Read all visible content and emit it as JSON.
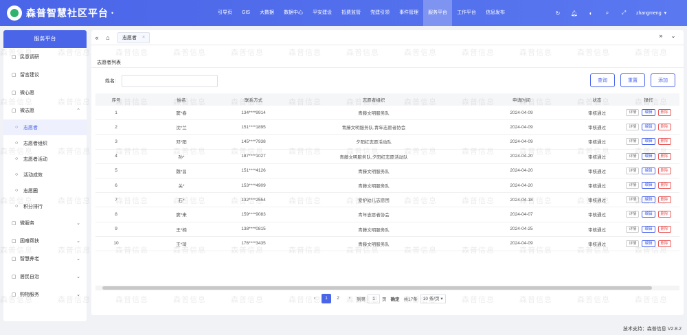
{
  "app": {
    "title": "森普智慧社区平台"
  },
  "topnav": [
    "引导页",
    "GIS",
    "大数据",
    "数据中心",
    "平安建设",
    "抵费监管",
    "党建引领",
    "事件管理",
    "服务平台",
    "工作平台",
    "信息发布"
  ],
  "topnav_active": "服务平台",
  "user": {
    "name": "zhangmeng"
  },
  "sidebar": {
    "title": "服务平台",
    "items": [
      {
        "label": "民意调研",
        "icon": "square-icon"
      },
      {
        "label": "留言建议",
        "icon": "message-icon"
      },
      {
        "label": "微心愿",
        "icon": "heart-icon"
      },
      {
        "label": "微志愿",
        "icon": "group-icon",
        "expanded": true
      }
    ],
    "subitems": [
      "志愿者",
      "志愿者组织",
      "志愿者活动",
      "活动成效",
      "志愿圈",
      "积分排行"
    ],
    "active_sub": "志愿者",
    "items_after": [
      "微服务",
      "困难帮扶",
      "智慧养老",
      "居民自治",
      "购物服务"
    ]
  },
  "tabs": [
    {
      "label": "志愿者"
    }
  ],
  "section": {
    "title": "志愿者列表"
  },
  "search": {
    "label": "姓名:",
    "placeholder": ""
  },
  "buttons": {
    "query": "查询",
    "reset": "重置",
    "add": "添加"
  },
  "table": {
    "headers": [
      "序号",
      "姓名",
      "联系方式",
      "志愿者组织",
      "申请时间",
      "状态",
      "操作"
    ],
    "ops": [
      "详情",
      "编辑",
      "删除"
    ],
    "rows": [
      [
        "1",
        "窦*春",
        "134****9914",
        "青藤文明服务队",
        "2024-04-09",
        "审核通过"
      ],
      [
        "2",
        "沈*兰",
        "151****1895",
        "青藤文明服务队,青年志愿者协会",
        "2024-04-09",
        "审核通过"
      ],
      [
        "3",
        "邓*阳",
        "145****7938",
        "夕阳红志愿活动队",
        "2024-04-09",
        "审核通过"
      ],
      [
        "4",
        "孙*",
        "187****1027",
        "青藤文明服务队,夕阳红志愿活动队",
        "2024-04-20",
        "审核通过"
      ],
      [
        "5",
        "魏*昌",
        "151****4126",
        "青藤文明服务队",
        "2024-04-20",
        "审核通过"
      ],
      [
        "6",
        "关*",
        "153****4909",
        "青藤文明服务队",
        "2024-04-20",
        "审核通过"
      ],
      [
        "7",
        "石*",
        "132****2554",
        "爱护幼儿志愿团",
        "2024-04-18",
        "审核通过"
      ],
      [
        "8",
        "窦*来",
        "159****9083",
        "青年志愿者协会",
        "2024-04-07",
        "审核通过"
      ],
      [
        "9",
        "王*楠",
        "138****0815",
        "青藤文明服务队",
        "2024-04-25",
        "审核通过"
      ],
      [
        "10",
        "王*琦",
        "176****3435",
        "青藤文明服务队",
        "2024-04-09",
        "审核通过"
      ]
    ]
  },
  "pager": {
    "pages": [
      "1",
      "2"
    ],
    "current": "1",
    "goto_label": "到第",
    "goto_value": "1",
    "page_unit": "页",
    "confirm": "确定",
    "total": "共17条",
    "size": "10 条/页"
  },
  "footer": "技术支持：森普信息  V2.8.2",
  "watermark": "森普信息",
  "colors": {
    "primary": "#4a65e8",
    "danger": "#e85a5a"
  }
}
